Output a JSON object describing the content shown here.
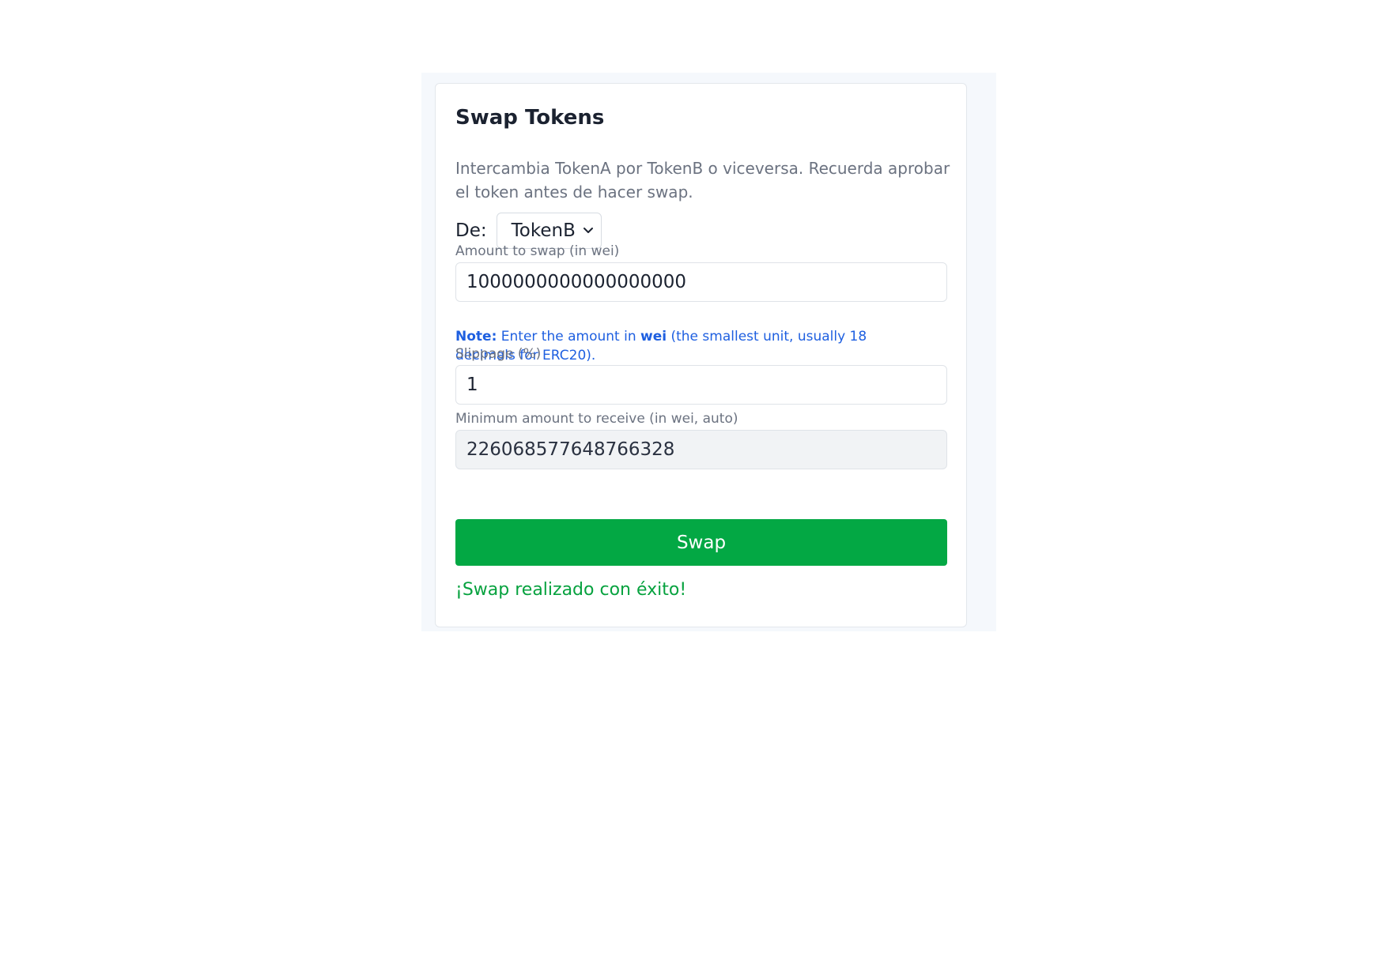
{
  "card": {
    "title": "Swap Tokens",
    "description": "Intercambia TokenA por TokenB o viceversa. Recuerda aprobar el token antes de hacer swap."
  },
  "from": {
    "label": "De:",
    "selected": "TokenB",
    "icon": "chevron-down-icon"
  },
  "amount": {
    "label": "Amount to swap (in wei)",
    "value": "1000000000000000000"
  },
  "note": {
    "prefix": "Note:",
    "text_before": " Enter the amount in ",
    "emphasis": "wei",
    "text_after": " (the smallest unit, usually 18 decimals for ERC20)."
  },
  "slippage": {
    "label": "Slippage (%)",
    "value": "1"
  },
  "min_receive": {
    "label": "Minimum amount to receive (in wei, auto)",
    "value": "226068577648766328"
  },
  "actions": {
    "swap_label": "Swap"
  },
  "status": {
    "message": "¡Swap realizado con éxito!"
  },
  "colors": {
    "primary_button": "#03a844",
    "success_text": "#07a23f",
    "note_text": "#1e5fe0",
    "panel_background": "#f5f8fc"
  }
}
